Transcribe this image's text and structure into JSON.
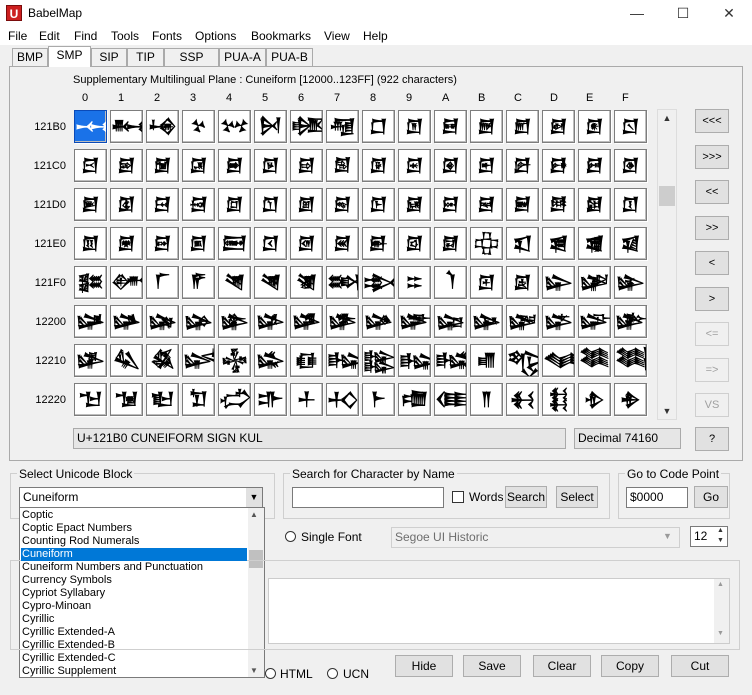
{
  "window": {
    "app_icon": "U",
    "title": "BabelMap",
    "minimize": "—",
    "maximize": "☐",
    "close": "✕"
  },
  "menu": [
    "File",
    "Edit",
    "Find",
    "Tools",
    "Fonts",
    "Options",
    "Bookmarks",
    "View",
    "Help"
  ],
  "tabs": [
    "BMP",
    "SMP",
    "SIP",
    "TIP",
    "SSP",
    "PUA-A",
    "PUA-B"
  ],
  "active_tab": "SMP",
  "plane_title": "Supplementary Multilingual Plane : Cuneiform [12000..123FF] (922 characters)",
  "column_headers": [
    "0",
    "1",
    "2",
    "3",
    "4",
    "5",
    "6",
    "7",
    "8",
    "9",
    "A",
    "B",
    "C",
    "D",
    "E",
    "F"
  ],
  "row_headers": [
    "121B0",
    "121C0",
    "121D0",
    "121E0",
    "121F0",
    "12200",
    "12210",
    "12220"
  ],
  "grid": [
    [
      "𒆰",
      "𒆱",
      "𒆲",
      "𒆳",
      "𒆴",
      "𒆵",
      "𒆶",
      "𒆷",
      "𒆸",
      "𒆹",
      "𒆺",
      "𒆻",
      "𒆼",
      "𒆽",
      "𒆾",
      "𒆿"
    ],
    [
      "𒇀",
      "𒇁",
      "𒇂",
      "𒇃",
      "𒇄",
      "𒇅",
      "𒇆",
      "𒇇",
      "𒇈",
      "𒇉",
      "𒇊",
      "𒇋",
      "𒇌",
      "𒇍",
      "𒇎",
      "𒇏"
    ],
    [
      "𒇐",
      "𒇑",
      "𒇒",
      "𒇓",
      "𒇔",
      "𒇕",
      "𒇖",
      "𒇗",
      "𒇘",
      "𒇙",
      "𒇚",
      "𒇛",
      "𒇜",
      "𒇝",
      "𒇞",
      "𒇟"
    ],
    [
      "𒇠",
      "𒇡",
      "𒇢",
      "𒇣",
      "𒇤",
      "𒇥",
      "𒇦",
      "𒇧",
      "𒇨",
      "𒇩",
      "𒇪",
      "𒇫",
      "𒇬",
      "𒇭",
      "𒇮",
      "𒇯"
    ],
    [
      "𒇰",
      "𒇱",
      "𒇲",
      "𒇳",
      "𒇴",
      "𒇵",
      "𒇶",
      "𒇷",
      "𒇸",
      "𒇹",
      "𒇺",
      "𒇻",
      "𒇼",
      "𒇽",
      "𒇾",
      "𒇿"
    ],
    [
      "𒈀",
      "𒈁",
      "𒈂",
      "𒈃",
      "𒈄",
      "𒈅",
      "𒈆",
      "𒈇",
      "𒈈",
      "𒈉",
      "𒈊",
      "𒈋",
      "𒈌",
      "𒈍",
      "𒈎",
      "𒈏"
    ],
    [
      "𒈐",
      "𒈑",
      "𒈒",
      "𒈓",
      "𒈔",
      "𒈕",
      "𒈖",
      "𒈗",
      "𒈘",
      "𒈙",
      "𒈚",
      "𒈛",
      "𒈜",
      "𒈝",
      "𒈞",
      "𒈟"
    ],
    [
      "𒈠",
      "𒈡",
      "𒈢",
      "𒈣",
      "𒈤",
      "𒈥",
      "𒈦",
      "𒈧",
      "𒈨",
      "𒈩",
      "𒈪",
      "𒈫",
      "𒈬",
      "𒈭",
      "𒈮",
      "𒈯"
    ]
  ],
  "selected_cell": {
    "row": 0,
    "col": 0
  },
  "nav_buttons": [
    "<<<",
    ">>>",
    "<<",
    ">>",
    "<",
    ">",
    "<=",
    "=>",
    "VS",
    "?"
  ],
  "status": {
    "char_name": "U+121B0 CUNEIFORM SIGN KUL",
    "decimal": "Decimal 74160"
  },
  "unicode_block": {
    "label": "Select Unicode Block",
    "selected": "Cuneiform",
    "options": [
      "Coptic",
      "Coptic Epact Numbers",
      "Counting Rod Numerals",
      "Cuneiform",
      "Cuneiform Numbers and Punctuation",
      "Currency Symbols",
      "Cypriot Syllabary",
      "Cypro-Minoan",
      "Cyrillic",
      "Cyrillic Extended-A",
      "Cyrillic Extended-B",
      "Cyrillic Extended-C",
      "Cyrillic Supplement"
    ]
  },
  "search": {
    "label": "Search for Character by Name",
    "value": "",
    "words_label": "Words",
    "search_button": "Search",
    "select_button": "Select"
  },
  "goto": {
    "label": "Go to Code Point",
    "value": "$0000",
    "button": "Go"
  },
  "font": {
    "single_font_label": "Single Font",
    "font_name": "Segoe UI Historic",
    "font_size": "12"
  },
  "output": {
    "html_label": "HTML",
    "ucn_label": "UCN",
    "hide": "Hide",
    "save": "Save",
    "clear": "Clear",
    "copy": "Copy",
    "cut": "Cut"
  }
}
